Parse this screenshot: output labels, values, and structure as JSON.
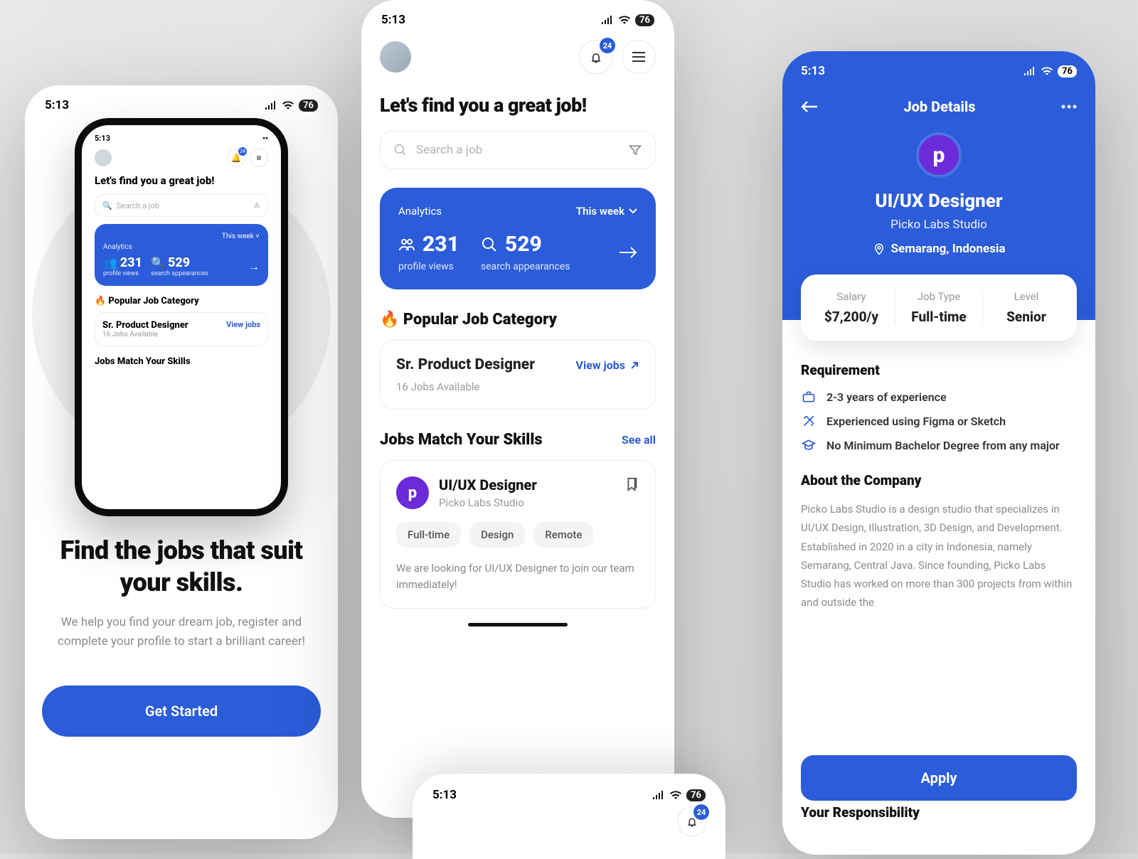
{
  "status": {
    "time": "5:13",
    "battery": "76"
  },
  "onboard": {
    "headline": "Find the jobs that suit your skills.",
    "sub": "We help you find your dream job, register and complete your profile to start a brilliant career!",
    "cta": "Get Started",
    "mock": {
      "heading": "Let's find you a great job!",
      "search_ph": "Search a job",
      "analytics_label": "Analytics",
      "this_week": "This week",
      "pv_val": "231",
      "pv_lbl": "profile views",
      "sa_val": "529",
      "sa_lbl": "search appearances",
      "popular": "🔥 Popular Job Category",
      "job_title": "Sr. Product Designer",
      "job_avail": "16 Jobs Available",
      "view_jobs": "View jobs",
      "match": "Jobs Match Your Skills",
      "notif": "24"
    }
  },
  "home": {
    "notif_count": "24",
    "heading": "Let's find you a great job!",
    "search_placeholder": "Search a job",
    "analytics": {
      "label": "Analytics",
      "period": "This week",
      "profile_views": "231",
      "profile_views_label": "profile views",
      "search_appearances": "529",
      "search_appearances_label": "search appearances"
    },
    "popular_section": "🔥 Popular Job Category",
    "category": {
      "name": "Sr. Product Designer",
      "available": "16 Jobs Available",
      "view": "View jobs"
    },
    "match_section": "Jobs Match Your Skills",
    "see_all": "See all",
    "job": {
      "title": "UI/UX Designer",
      "company": "Picko Labs Studio",
      "tags": [
        "Full-time",
        "Design",
        "Remote"
      ],
      "desc": "We are looking for UI/UX Designer to join our team immediately!"
    }
  },
  "detail": {
    "title": "Job Details",
    "role": "UI/UX Designer",
    "company": "Picko Labs Studio",
    "location": "Semarang, Indonesia",
    "cols": {
      "salary_l": "Salary",
      "salary_v": "$7,200/y",
      "type_l": "Job Type",
      "type_v": "Full-time",
      "level_l": "Level",
      "level_v": "Senior"
    },
    "req_title": "Requirement",
    "req": [
      "2-3 years of experience",
      "Experienced using Figma or Sketch",
      "No Minimum Bachelor Degree from any major"
    ],
    "about_title": "About the Company",
    "about": "Picko Labs Studio is a design studio that specializes in UI/UX Design, Illustration, 3D Design, and Development. Established in 2020 in a city in Indonesia, namely Semarang, Central Java. Since founding, Picko Labs Studio has worked on more than 300 projects from within and outside the",
    "apply": "Apply",
    "resp_title": "Your Responsibility"
  },
  "peek": {
    "notif": "24"
  }
}
